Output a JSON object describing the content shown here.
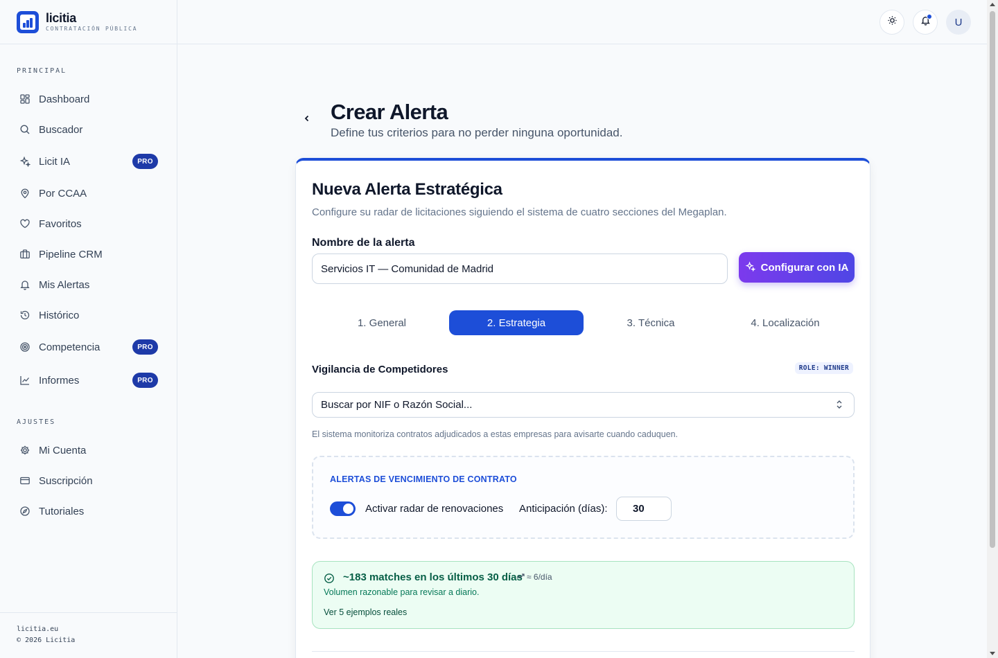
{
  "brand": {
    "name": "licitia",
    "tagline": "CONTRATACIÓN PÚBLICA"
  },
  "sidebar": {
    "section_main": "PRINCIPAL",
    "section_settings": "AJUSTES",
    "items": [
      {
        "label": "Dashboard",
        "icon": "dashboard-icon"
      },
      {
        "label": "Buscador",
        "icon": "search-icon"
      },
      {
        "label": "Licit IA",
        "icon": "sparkles-icon",
        "badge": "PRO"
      },
      {
        "label": "Por CCAA",
        "icon": "map-pin-icon"
      },
      {
        "label": "Favoritos",
        "icon": "heart-icon"
      },
      {
        "label": "Pipeline CRM",
        "icon": "briefcase-icon"
      },
      {
        "label": "Mis Alertas",
        "icon": "bell-icon"
      },
      {
        "label": "Histórico",
        "icon": "history-icon"
      },
      {
        "label": "Competencia",
        "icon": "target-icon",
        "badge": "PRO"
      },
      {
        "label": "Informes",
        "icon": "line-chart-icon",
        "badge": "PRO"
      }
    ],
    "settings_items": [
      {
        "label": "Mi Cuenta",
        "icon": "gear-icon"
      },
      {
        "label": "Suscripción",
        "icon": "credit-card-icon"
      },
      {
        "label": "Tutoriales",
        "icon": "compass-icon"
      }
    ],
    "footer": {
      "site": "licitia.eu",
      "copyright": "© 2026 Licitia"
    }
  },
  "topbar": {
    "avatar_initial": "U",
    "has_notification": true
  },
  "page": {
    "title": "Crear Alerta",
    "subtitle": "Define tus criterios para no perder ninguna oportunidad."
  },
  "card": {
    "title": "Nueva Alerta Estratégica",
    "subtitle": "Configure su radar de licitaciones siguiendo el sistema de cuatro secciones del Megaplan.",
    "name_label": "Nombre de la alerta",
    "name_value": "Servicios IT — Comunidad de Madrid",
    "ai_button": "Configurar con IA",
    "tabs": [
      "1. General",
      "2. Estrategia",
      "3. Técnica",
      "4. Localización"
    ],
    "active_tab": 1,
    "competitors": {
      "title": "Vigilancia de Competidores",
      "role_badge": "ROLE: WINNER",
      "placeholder": "Buscar por NIF o Razón Social...",
      "helper": "El sistema monitoriza contratos adjudicados a estas empresas para avisarte cuando caduquen."
    },
    "expiry": {
      "title": "ALERTAS DE VENCIMIENTO DE CONTRATO",
      "toggle_label": "Activar radar de renovaciones",
      "toggle_on": true,
      "anticipation_label": "Anticipación (días):",
      "anticipation_value": "30"
    },
    "matches": {
      "title": "~183 matches en los últimos 30 días",
      "rate": "≈ 6/día",
      "subtitle": "Volumen razonable para revisar a diario.",
      "link": "Ver 5 ejemplos reales"
    }
  },
  "colors": {
    "primary": "#1d4ed8",
    "pro_badge": "#1e3aa8",
    "success_bg": "#ecfdf3",
    "success_text": "#065f46"
  }
}
